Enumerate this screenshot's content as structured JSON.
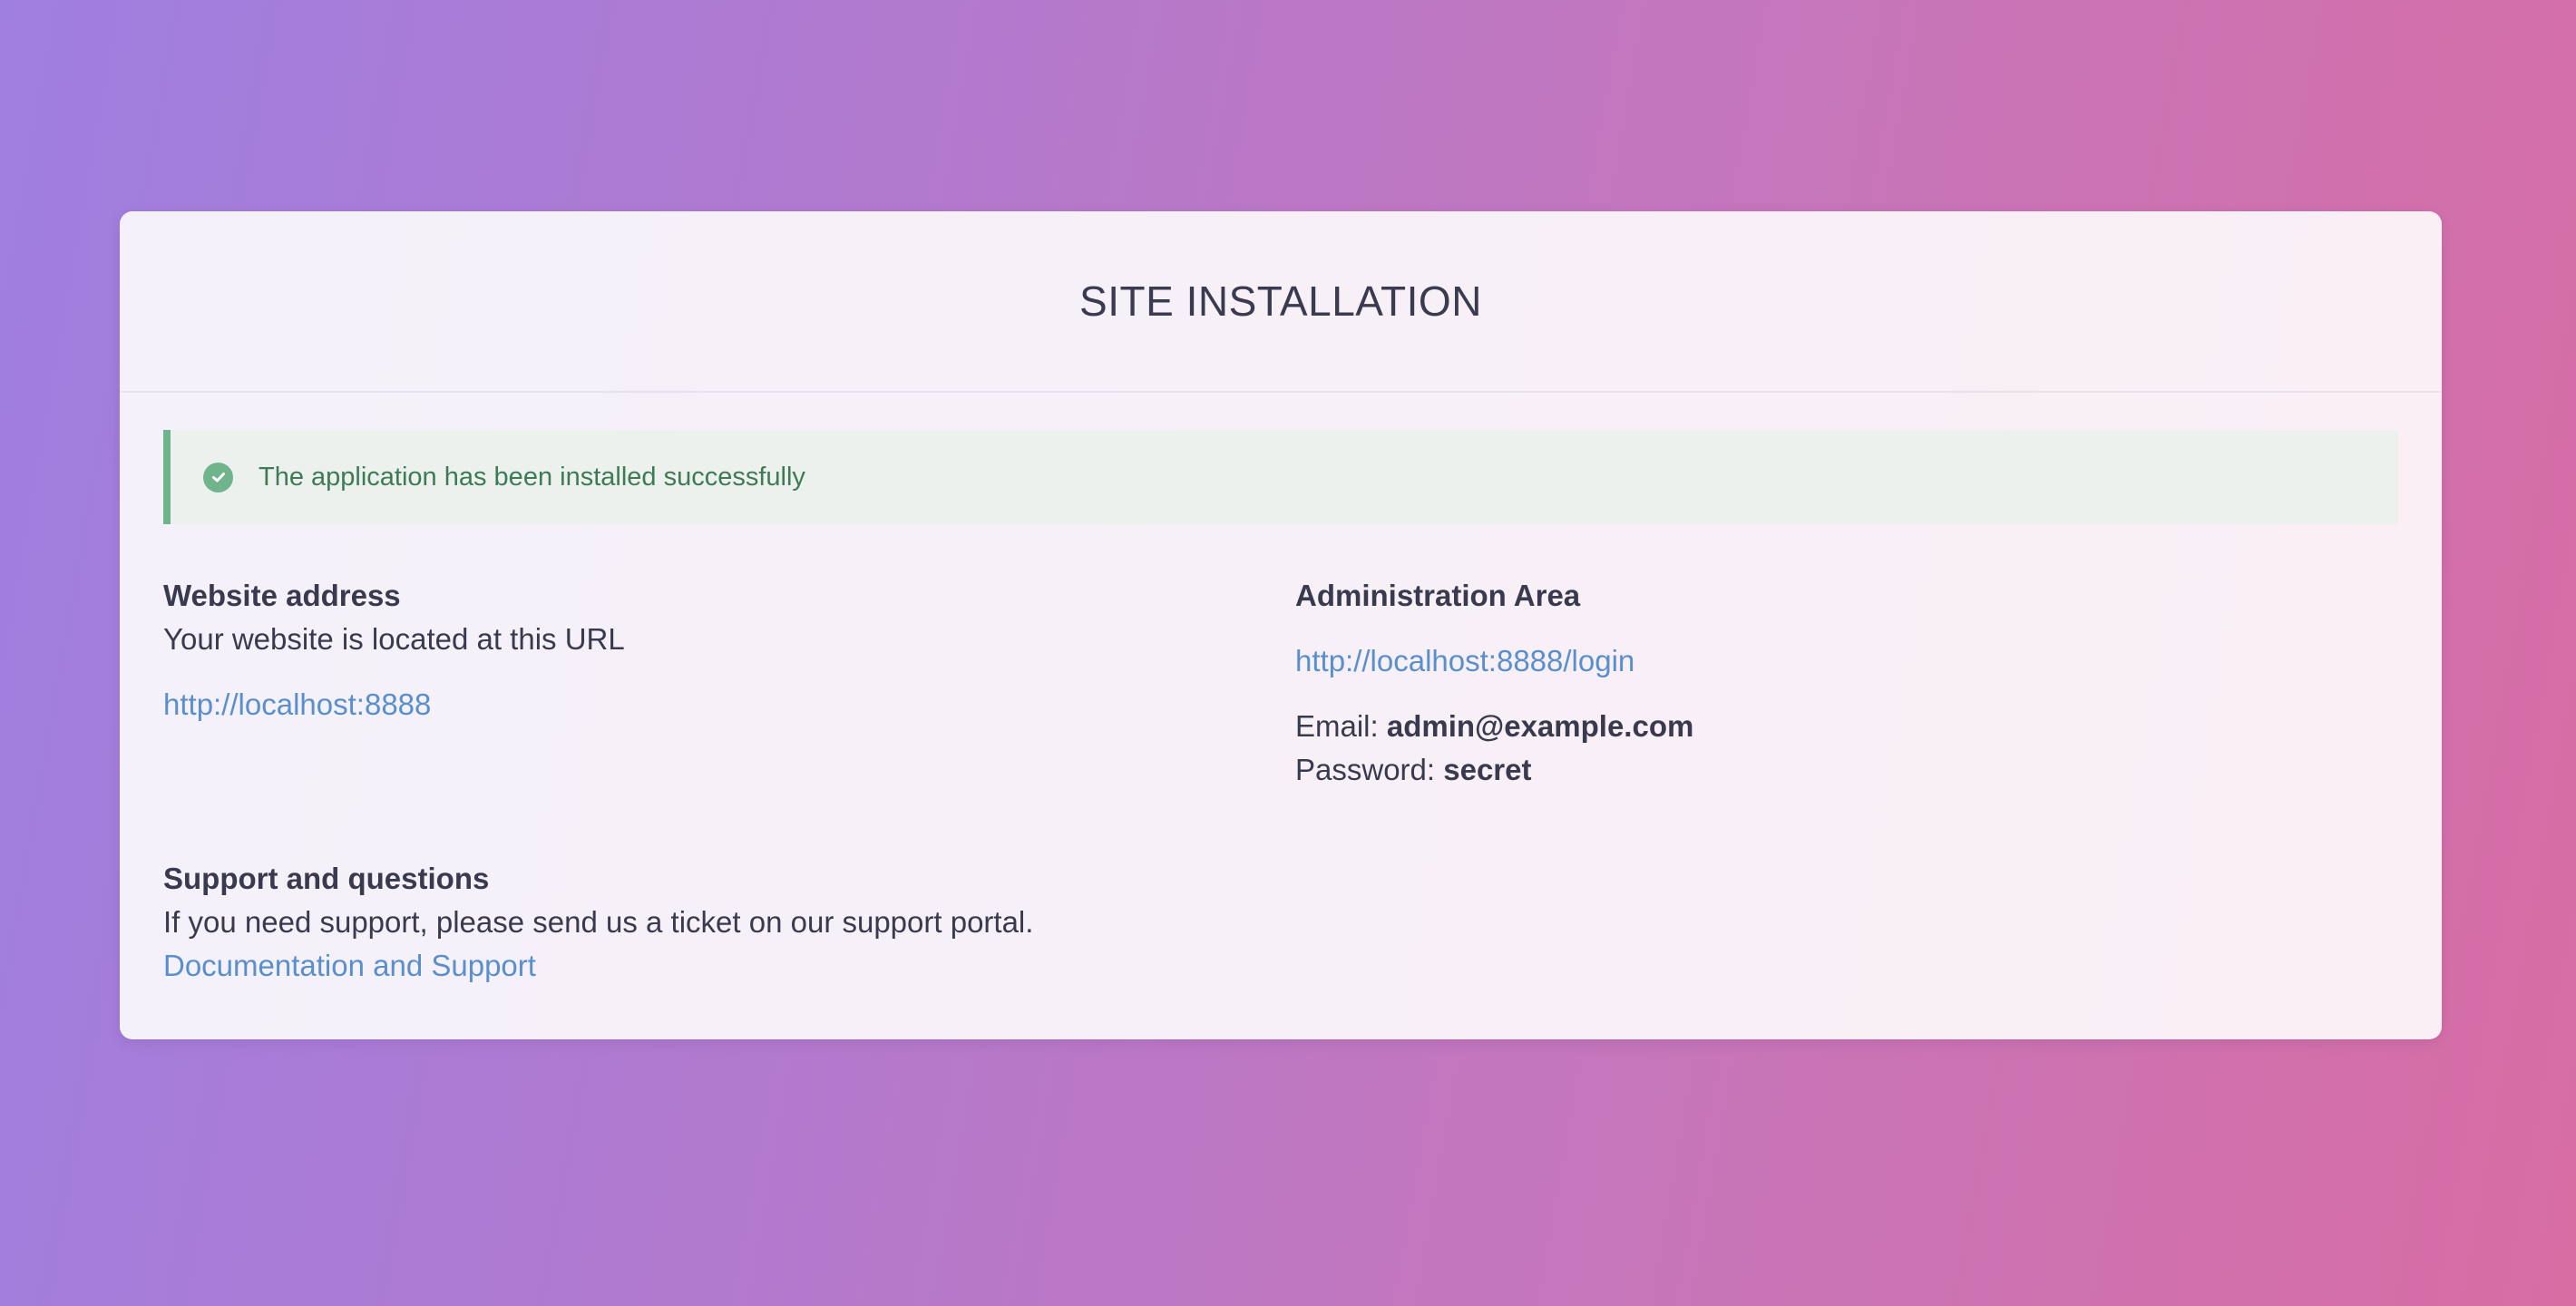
{
  "header": {
    "title": "SITE INSTALLATION"
  },
  "alert": {
    "icon": "check-circle-icon",
    "message": "The application has been installed successfully",
    "color": "#6fb48a"
  },
  "website": {
    "heading": "Website address",
    "description": "Your website is located at this URL",
    "url": "http://localhost:8888"
  },
  "admin": {
    "heading": "Administration Area",
    "login_url": "http://localhost:8888/login",
    "email_label": "Email:",
    "email_value": "admin@example.com",
    "password_label": "Password:",
    "password_value": "secret"
  },
  "support": {
    "heading": "Support and questions",
    "description": "If you need support, please send us a ticket on our support portal.",
    "link_label": "Documentation and Support"
  },
  "colors": {
    "link": "#5a8fce",
    "success": "#6fb48a",
    "text": "#3a3a4e"
  }
}
